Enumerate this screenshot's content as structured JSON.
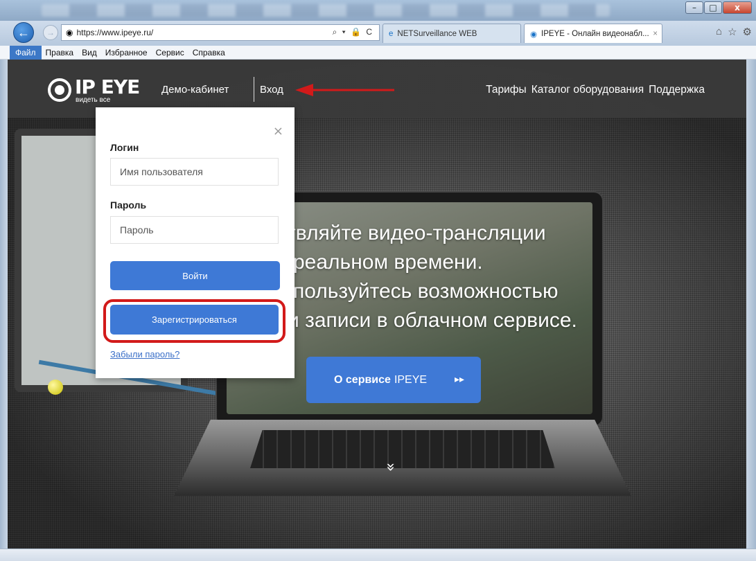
{
  "browser": {
    "window_buttons": {
      "minimize": "–",
      "maximize": "□",
      "close": "x"
    },
    "address": {
      "url": "https://www.ipeye.ru/",
      "tools": "⌕ ▾ 🔒 C"
    },
    "tabs": [
      {
        "label": "NETSurveillance WEB"
      },
      {
        "label": "IPEYE - Онлайн видеонабл...",
        "close": "×"
      }
    ],
    "nav_icons": {
      "home": "⌂",
      "favorites": "☆",
      "settings": "⚙"
    },
    "menu": [
      "Файл",
      "Правка",
      "Вид",
      "Избранное",
      "Сервис",
      "Справка"
    ]
  },
  "site": {
    "logo": {
      "text": "IP EYE",
      "tagline": "видеть все"
    },
    "nav": {
      "demo": "Демо-кабинет",
      "login": "Вход",
      "right": [
        "Тарифы",
        "Каталог оборудования",
        "Поддержка"
      ]
    },
    "hero": {
      "lines": [
        "твляйте видео-трансляции",
        "реальном времени.",
        "пользуйтесь возможностью",
        "и записи в облачном сервисе."
      ],
      "about_button": {
        "bold": "О сервисе",
        "light": "IPEYE",
        "icon": "▸▸"
      },
      "scroll_icon": "»"
    },
    "login_popup": {
      "close": "×",
      "login_label": "Логин",
      "login_placeholder": "Имя пользователя",
      "password_label": "Пароль",
      "password_placeholder": "Пароль",
      "submit": "Войти",
      "register": "Зарегистрироваться",
      "forgot": "Забыли пароль?"
    }
  },
  "colors": {
    "accent": "#3e79d6",
    "annotation_red": "#d21a1a",
    "header_bg": "#3a3a3a"
  }
}
